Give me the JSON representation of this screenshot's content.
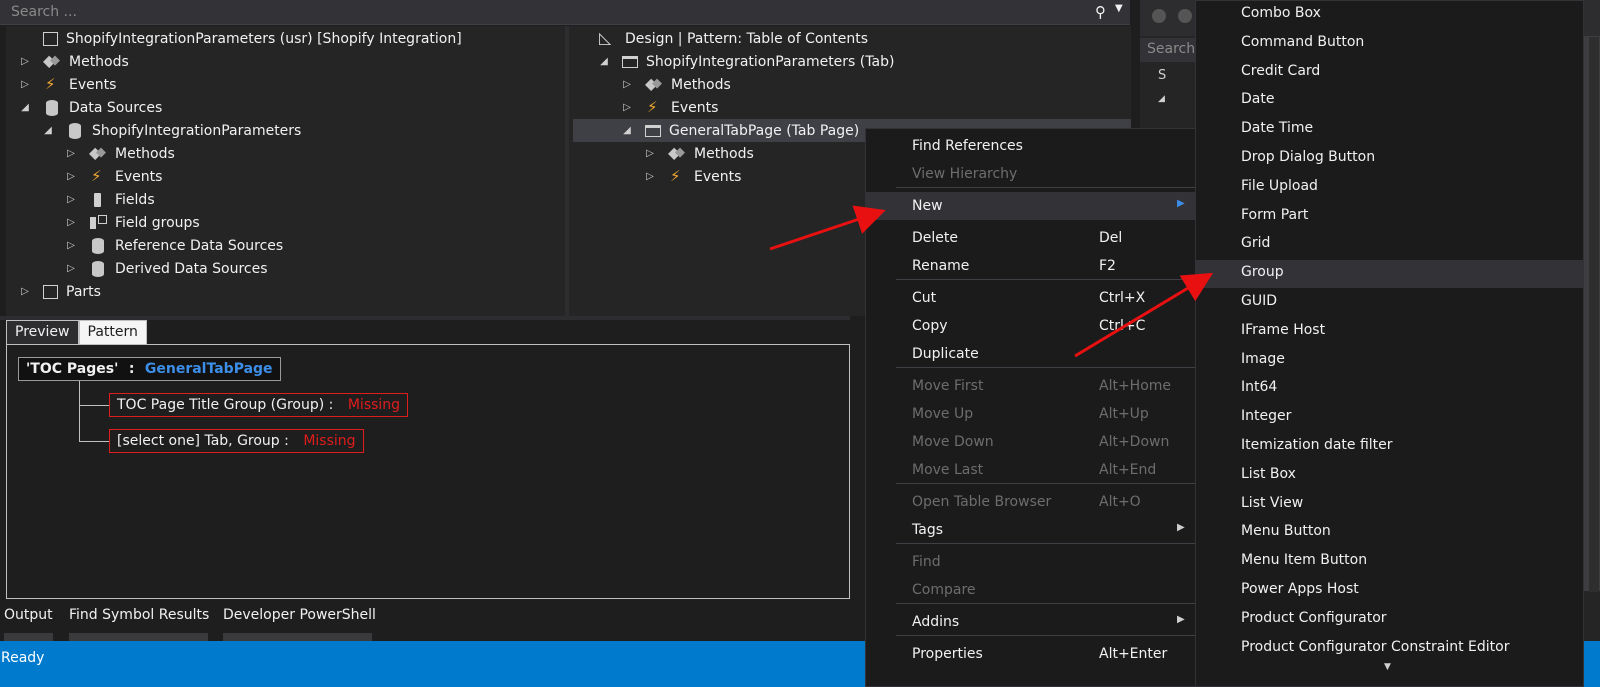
{
  "search": {
    "placeholder": "Search ..."
  },
  "left_tree": [
    {
      "label": "ShopifyIntegrationParameters (usr) [Shopify Integration]",
      "icon": "form-icon",
      "arrow": ""
    },
    {
      "label": "Methods",
      "icon": "methods-icon",
      "arrow": "▷"
    },
    {
      "label": "Events",
      "icon": "events-icon",
      "arrow": "▷"
    },
    {
      "label": "Data Sources",
      "icon": "datasource-icon",
      "arrow": "◢"
    },
    {
      "label": "ShopifyIntegrationParameters",
      "icon": "datasource-icon",
      "arrow": "◢"
    },
    {
      "label": "Methods",
      "icon": "methods-icon",
      "arrow": "▷"
    },
    {
      "label": "Events",
      "icon": "events-icon",
      "arrow": "▷"
    },
    {
      "label": "Fields",
      "icon": "field-icon",
      "arrow": "▷"
    },
    {
      "label": "Field groups",
      "icon": "fieldgroup-icon",
      "arrow": "▷"
    },
    {
      "label": "Reference Data Sources",
      "icon": "datasource-icon",
      "arrow": "▷"
    },
    {
      "label": "Derived Data Sources",
      "icon": "datasource-icon",
      "arrow": "▷"
    },
    {
      "label": "Parts",
      "icon": "form-icon",
      "arrow": "▷"
    }
  ],
  "right_tree": [
    {
      "label": "Design | Pattern: Table of Contents",
      "icon": "design-icon",
      "arrow": ""
    },
    {
      "label": "ShopifyIntegrationParameters (Tab)",
      "icon": "folder-icon",
      "arrow": "◢"
    },
    {
      "label": "Methods",
      "icon": "methods-icon",
      "arrow": "▷"
    },
    {
      "label": "Events",
      "icon": "events-icon",
      "arrow": "▷"
    },
    {
      "label": "GeneralTabPage (Tab Page)",
      "icon": "folder-icon",
      "arrow": "◢"
    },
    {
      "label": "Methods",
      "icon": "methods-icon",
      "arrow": "▷"
    },
    {
      "label": "Events",
      "icon": "events-icon",
      "arrow": "▷"
    }
  ],
  "pattern_tabs": {
    "preview": "Preview",
    "pattern": "Pattern"
  },
  "pattern": {
    "root_key": "'TOC Pages'",
    "root_sep": ":",
    "root_value": "GeneralTabPage",
    "nodes": [
      {
        "label": "TOC Page Title Group  (Group) :",
        "status": "Missing"
      },
      {
        "label": "[select one]  Tab, Group :",
        "status": "Missing"
      }
    ]
  },
  "bottom_tabs": [
    "Output",
    "Find Symbol Results",
    "Developer PowerShell"
  ],
  "status": {
    "text": "Ready"
  },
  "right_panel": {
    "search_placeholder": "Search",
    "node_label": "S"
  },
  "context_menu": [
    {
      "label": "Find References",
      "shortcut": "",
      "disabled": false
    },
    {
      "label": "View Hierarchy",
      "shortcut": "",
      "disabled": true
    },
    {
      "label": "New",
      "shortcut": "",
      "disabled": false,
      "submenu": true
    },
    {
      "label": "Delete",
      "shortcut": "Del",
      "disabled": false
    },
    {
      "label": "Rename",
      "shortcut": "F2",
      "disabled": false
    },
    {
      "label": "Cut",
      "shortcut": "Ctrl+X",
      "disabled": false
    },
    {
      "label": "Copy",
      "shortcut": "Ctrl+C",
      "disabled": false
    },
    {
      "label": "Duplicate",
      "shortcut": "",
      "disabled": false
    },
    {
      "label": "Move First",
      "shortcut": "Alt+Home",
      "disabled": true
    },
    {
      "label": "Move Up",
      "shortcut": "Alt+Up",
      "disabled": true
    },
    {
      "label": "Move Down",
      "shortcut": "Alt+Down",
      "disabled": true
    },
    {
      "label": "Move Last",
      "shortcut": "Alt+End",
      "disabled": true
    },
    {
      "label": "Open Table Browser",
      "shortcut": "Alt+O",
      "disabled": true
    },
    {
      "label": "Tags",
      "shortcut": "",
      "disabled": false,
      "submenu": true
    },
    {
      "label": "Find",
      "shortcut": "",
      "disabled": true
    },
    {
      "label": "Compare",
      "shortcut": "",
      "disabled": true
    },
    {
      "label": "Addins",
      "shortcut": "",
      "disabled": false,
      "submenu": true
    },
    {
      "label": "Properties",
      "shortcut": "Alt+Enter",
      "disabled": false
    }
  ],
  "new_submenu": [
    "Combo Box",
    "Command Button",
    "Credit Card",
    "Date",
    "Date Time",
    "Drop Dialog Button",
    "File Upload",
    "Form Part",
    "Grid",
    "Group",
    "GUID",
    "IFrame Host",
    "Image",
    "Int64",
    "Integer",
    "Itemization date filter",
    "List Box",
    "List View",
    "Menu Button",
    "Menu Item Button",
    "Power Apps Host",
    "Product Configurator",
    "Product Configurator Constraint Editor"
  ],
  "highlighted": {
    "context_item": "New",
    "submenu_item": "Group"
  },
  "colors": {
    "accent": "#007acc",
    "link_blue": "#3c8ee8",
    "missing_red": "#e01c1c",
    "annotation_arrow": "#e81010"
  }
}
